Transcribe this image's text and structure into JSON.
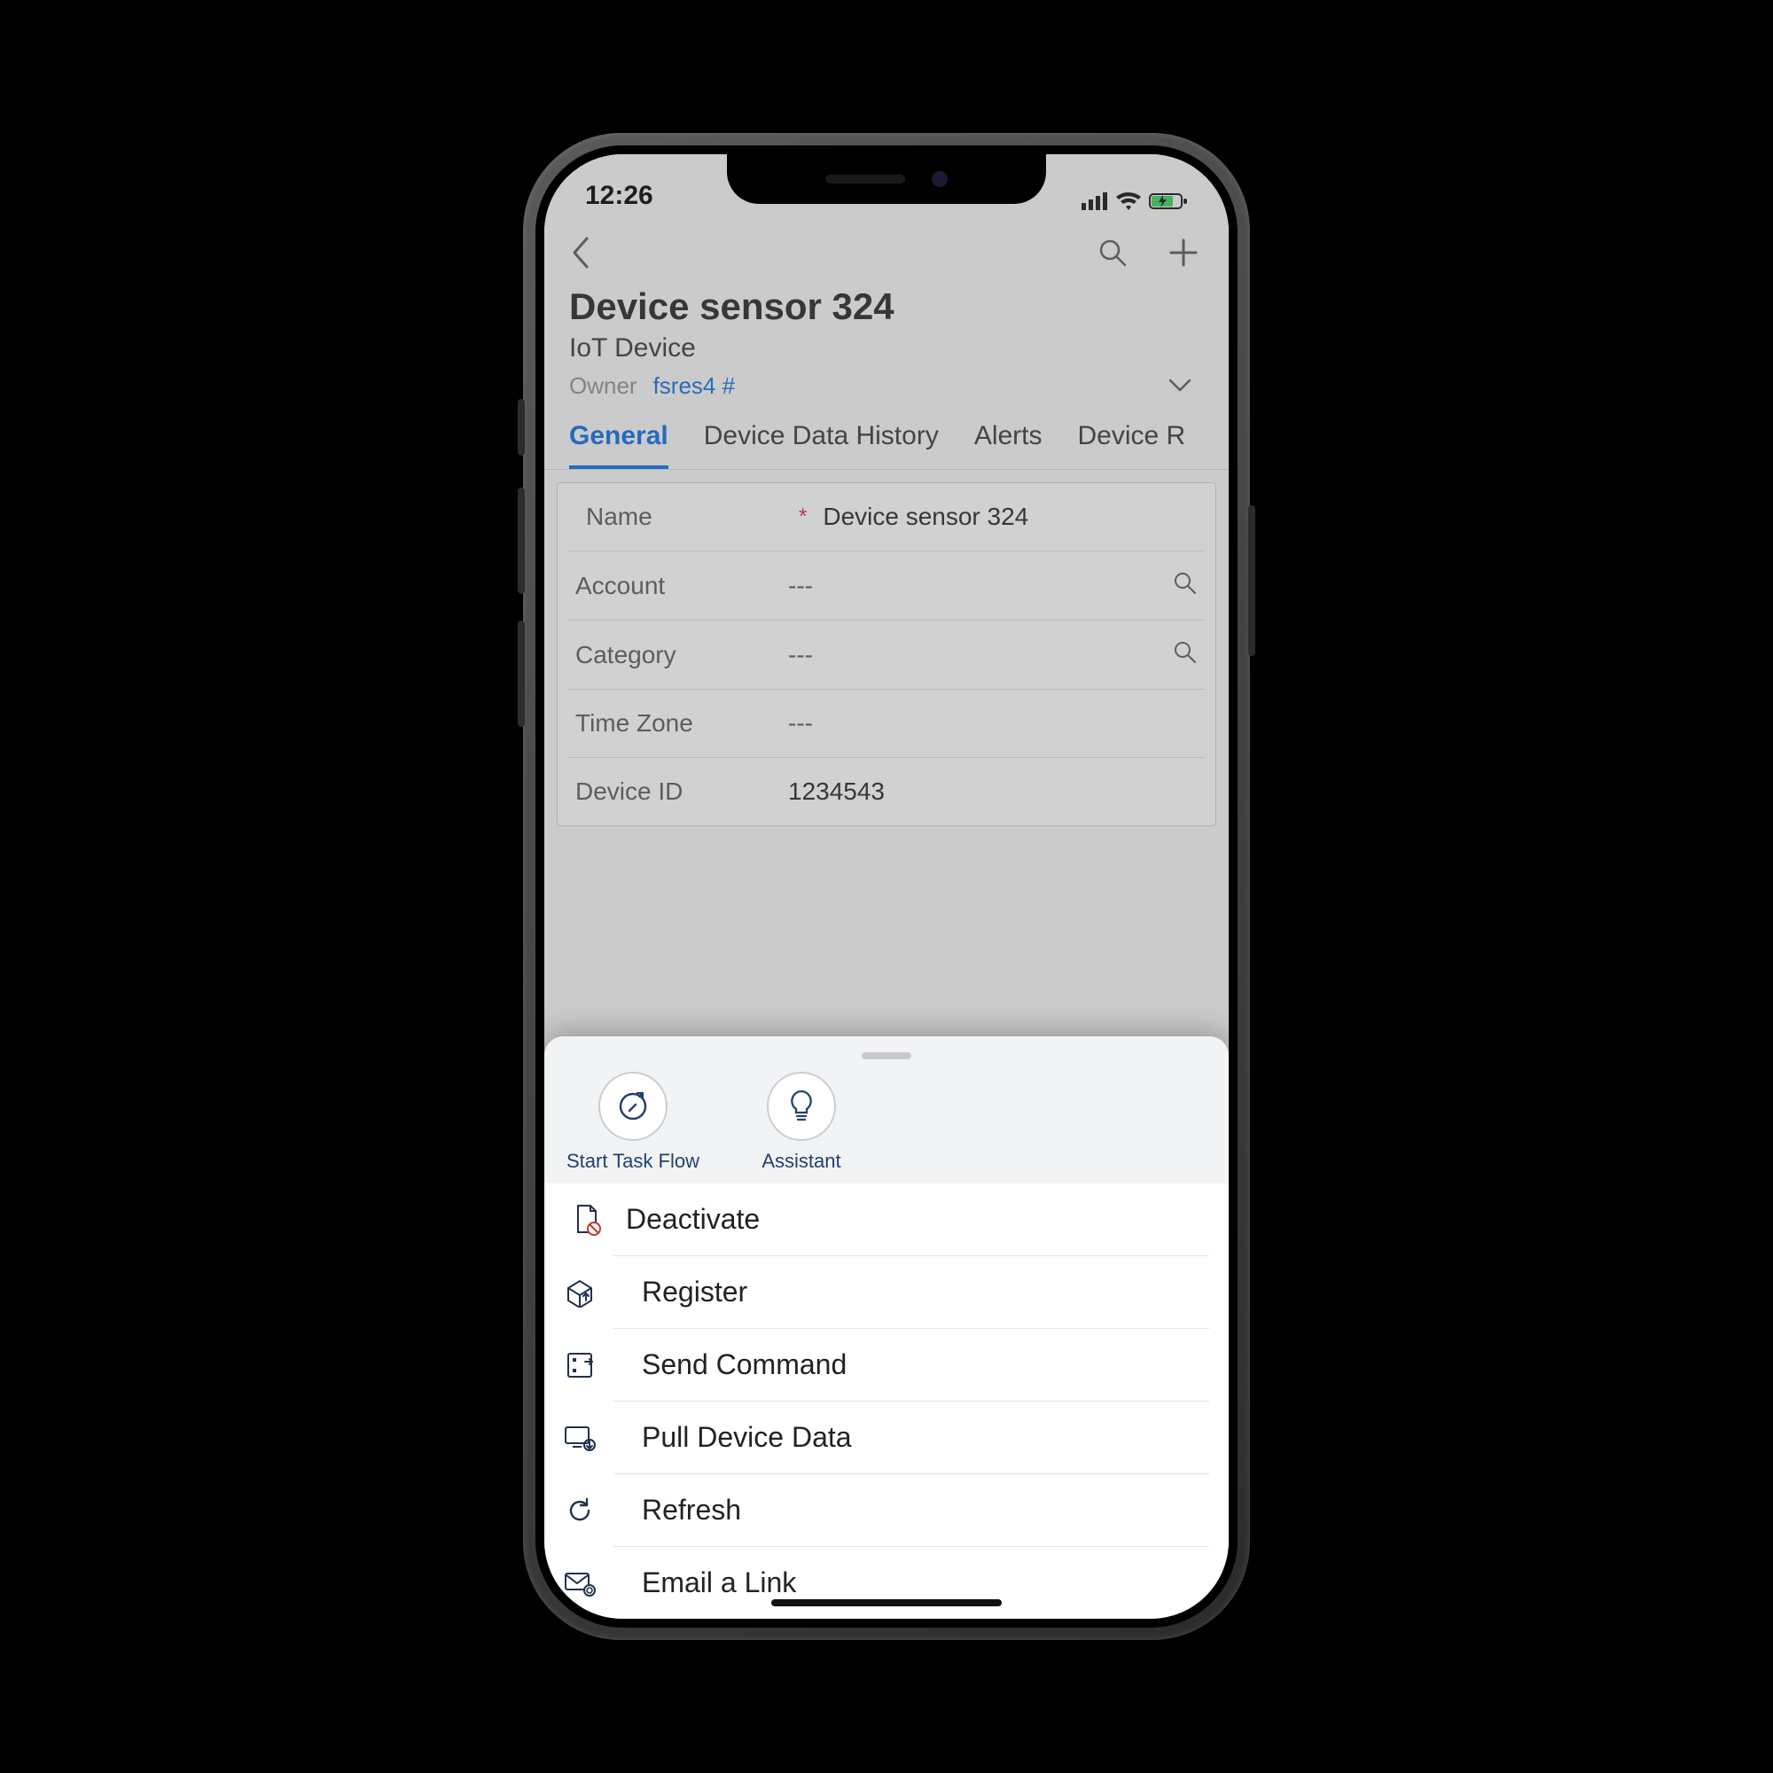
{
  "status": {
    "time": "12:26"
  },
  "header": {
    "title": "Device sensor 324",
    "subtitle": "IoT Device",
    "owner_label": "Owner",
    "owner_value": "fsres4 #"
  },
  "tabs": {
    "t0": "General",
    "t1": "Device Data History",
    "t2": "Alerts",
    "t3": "Device R"
  },
  "form": {
    "name_label": "Name",
    "name_value": "Device sensor 324",
    "account_label": "Account",
    "account_value": "---",
    "category_label": "Category",
    "category_value": "---",
    "timezone_label": "Time Zone",
    "timezone_value": "---",
    "deviceid_label": "Device ID",
    "deviceid_value": "1234543"
  },
  "sheet": {
    "quick": {
      "start_task_flow": "Start Task Flow",
      "assistant": "Assistant"
    },
    "actions": {
      "deactivate": "Deactivate",
      "register": "Register",
      "send_command": "Send Command",
      "pull_device_data": "Pull Device Data",
      "refresh": "Refresh",
      "email_link": "Email a Link"
    }
  }
}
